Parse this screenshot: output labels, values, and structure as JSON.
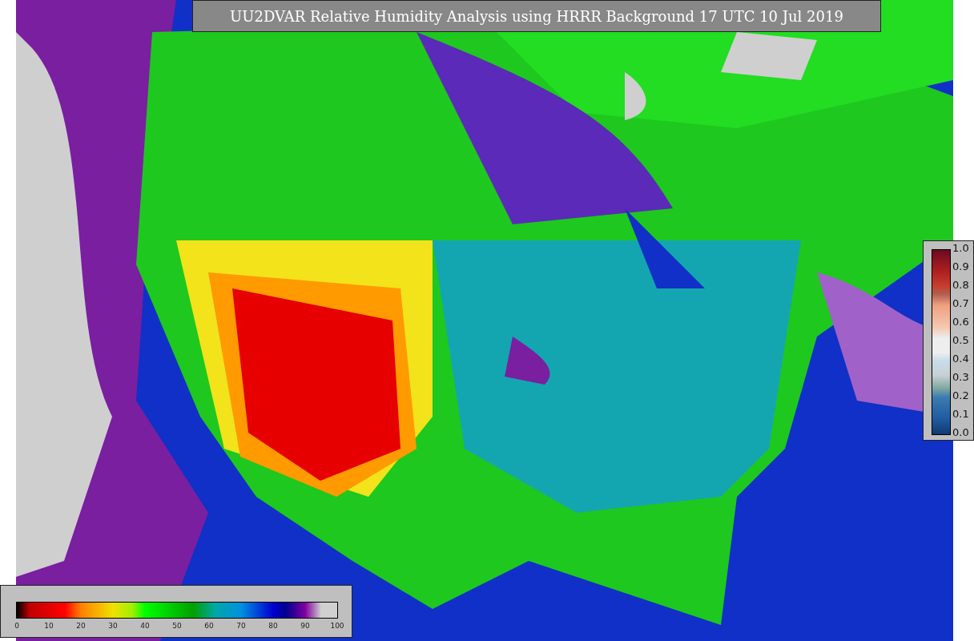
{
  "title": "UU2DVAR Relative Humidity Analysis using HRRR Background 17 UTC 10 Jul 2019",
  "humidity_colorbar": {
    "ticks": [
      "0",
      "10",
      "20",
      "30",
      "40",
      "50",
      "60",
      "70",
      "80",
      "90",
      "100"
    ]
  },
  "station_colorbar": {
    "ticks": [
      "1.0",
      "0.9",
      "0.8",
      "0.7",
      "0.6",
      "0.5",
      "0.4",
      "0.3",
      "0.2",
      "0.1",
      "0.0"
    ]
  }
}
